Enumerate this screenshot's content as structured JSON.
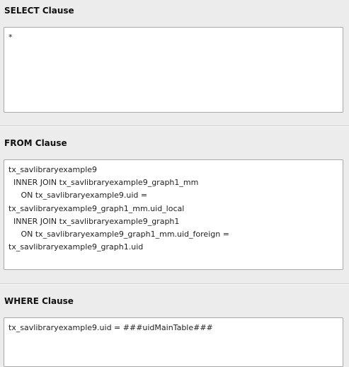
{
  "select_clause": {
    "title": "SELECT Clause",
    "value": "*"
  },
  "from_clause": {
    "title": "FROM Clause",
    "value": "tx_savlibraryexample9\n  INNER JOIN tx_savlibraryexample9_graph1_mm\n     ON tx_savlibraryexample9.uid =\ntx_savlibraryexample9_graph1_mm.uid_local\n  INNER JOIN tx_savlibraryexample9_graph1\n     ON tx_savlibraryexample9_graph1_mm.uid_foreign =\ntx_savlibraryexample9_graph1.uid"
  },
  "where_clause": {
    "title": "WHERE Clause",
    "value": "tx_savlibraryexample9.uid = ###uidMainTable###"
  }
}
